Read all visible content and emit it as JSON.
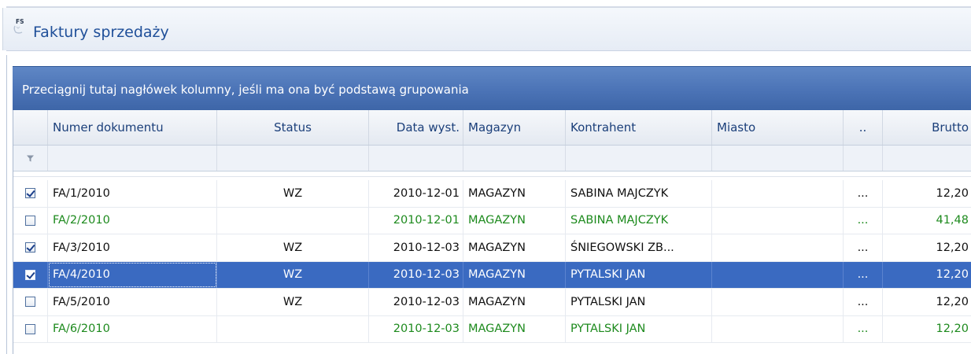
{
  "window": {
    "icon_label": "FS",
    "title": "Faktury sprzedaży"
  },
  "group_panel": {
    "hint": "Przeciągnij tutaj nagłówek kolumny, jeśli ma ona być podstawą grupowania"
  },
  "grid": {
    "columns": [
      {
        "key": "check",
        "label": ""
      },
      {
        "key": "numer",
        "label": "Numer dokumentu"
      },
      {
        "key": "status",
        "label": "Status"
      },
      {
        "key": "data",
        "label": "Data wyst."
      },
      {
        "key": "magazyn",
        "label": "Magazyn"
      },
      {
        "key": "kontrahent",
        "label": "Kontrahent"
      },
      {
        "key": "miasto",
        "label": "Miasto"
      },
      {
        "key": "more",
        "label": ".."
      },
      {
        "key": "brutto",
        "label": "Brutto"
      }
    ],
    "rows": [
      {
        "checked": true,
        "color": "black",
        "numer": "FA/1/2010",
        "status": "WZ",
        "data": "2010-12-01",
        "magazyn": "MAGAZYN",
        "kontrahent": "SABINA MAJCZYK",
        "miasto": "",
        "more": "...",
        "brutto": "12,20",
        "selected": false
      },
      {
        "checked": false,
        "color": "green",
        "numer": "FA/2/2010",
        "status": "",
        "data": "2010-12-01",
        "magazyn": "MAGAZYN",
        "kontrahent": "SABINA MAJCZYK",
        "miasto": "",
        "more": "...",
        "brutto": "41,48",
        "selected": false
      },
      {
        "checked": true,
        "color": "black",
        "numer": "FA/3/2010",
        "status": "WZ",
        "data": "2010-12-03",
        "magazyn": "MAGAZYN",
        "kontrahent": "ŚNIEGOWSKI ZB...",
        "miasto": "",
        "more": "...",
        "brutto": "12,20",
        "selected": false
      },
      {
        "checked": true,
        "color": "black",
        "numer": "FA/4/2010",
        "status": "WZ",
        "data": "2010-12-03",
        "magazyn": "MAGAZYN",
        "kontrahent": "PYTALSKI JAN",
        "miasto": "",
        "more": "...",
        "brutto": "12,20",
        "selected": true
      },
      {
        "checked": false,
        "color": "black",
        "numer": "FA/5/2010",
        "status": "WZ",
        "data": "2010-12-03",
        "magazyn": "MAGAZYN",
        "kontrahent": "PYTALSKI JAN",
        "miasto": "",
        "more": "...",
        "brutto": "12,20",
        "selected": false
      },
      {
        "checked": false,
        "color": "green",
        "numer": "FA/6/2010",
        "status": "",
        "data": "2010-12-03",
        "magazyn": "MAGAZYN",
        "kontrahent": "PYTALSKI JAN",
        "miasto": "",
        "more": "...",
        "brutto": "12,20",
        "selected": false
      }
    ]
  },
  "colors": {
    "selection": "#3a6ac1",
    "green_text": "#1d8a1d",
    "header_text": "#1b3f7a",
    "group_panel": "#4b73b6"
  }
}
